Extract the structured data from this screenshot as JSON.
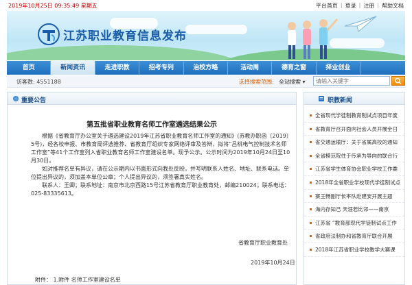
{
  "topbar": {
    "date": "2019年10月25日 09:35:49 星期五",
    "links": [
      "平台首页",
      "登录",
      "注册",
      "帮助文档"
    ]
  },
  "header": {
    "site_title": "江苏职业教育信息发布"
  },
  "nav": {
    "items": [
      {
        "label": "首页",
        "active": false
      },
      {
        "label": "新闻资讯",
        "active": true
      },
      {
        "label": "走进职教",
        "active": false
      },
      {
        "label": "招考专列",
        "active": false
      },
      {
        "label": "治校方略",
        "active": false
      },
      {
        "label": "活动周",
        "active": false
      },
      {
        "label": "德育之窗",
        "active": false
      },
      {
        "label": "择业创业",
        "active": false
      },
      {
        "label": "",
        "active": false
      }
    ]
  },
  "infobar": {
    "visits": "访客数: 4551188",
    "search_label": "选择搜索范围:",
    "search_scope": "全站搜索",
    "search_placeholder": "请输入关键字"
  },
  "main": {
    "panel_title": "重要公告",
    "article_title": "第五批省职业教育名师工作室遴选结果公示",
    "paragraphs": [
      "根据《省教育厅办公室关于遴选建设2019年江苏省职业教育名师工作室的通知》(苏教办职函〔2019〕5号)，经各校申报、市教育局评选推荐、省教育厅组织专家网络评审及答辩，拟将“吕桃电气控制技术名师工作室”等41个工作室列入省职业教育名师工作室建设名单。现予公示。公示时间为2019年10月24日至10月30日。",
      "如对推荐名单有异议，请在公示期内以书面形式向我处反映，并写明联系人姓名、地址、联系电话。单位提出异议的，须加盖本单位公章；个人提出异议的，须签署真实姓名。",
      "联系人：王卿；联系地址：南京市北京西路15号江苏省教育厅职业教育处，邮编210024；联系电话：025-83335613。"
    ],
    "signature": "省教育厅职业教育处",
    "sign_date": "2019年10月24日",
    "attachment_label": "附件：",
    "attachment_link": "1.附件  名师工作室建设名单"
  },
  "side": {
    "title": "职教新闻",
    "news": [
      "全省现代学徒制教育制试点项目年度",
      "省教育厅召开面向社会人员开展全日",
      "省交通运输厅：关于省属高校的通知",
      "全省模范院住于传承为导向的联合行",
      "江苏省学生体育协会职业学校工作委",
      "2018年全省职业学校现代学徒制试点",
      "赛王畅副厅长率队赴建安开展主题",
      "海内存知己 天涯若比邻——南京",
      "江苏省 “教育部现代学徒制试点工作",
      "省政府法制办和省教育厅联合开展",
      "2018年江苏省职业学校教学大赛课"
    ]
  },
  "colors": {
    "nav_blue": "#1f6fbe",
    "accent_orange": "#e06000",
    "date_red": "#c00000"
  }
}
